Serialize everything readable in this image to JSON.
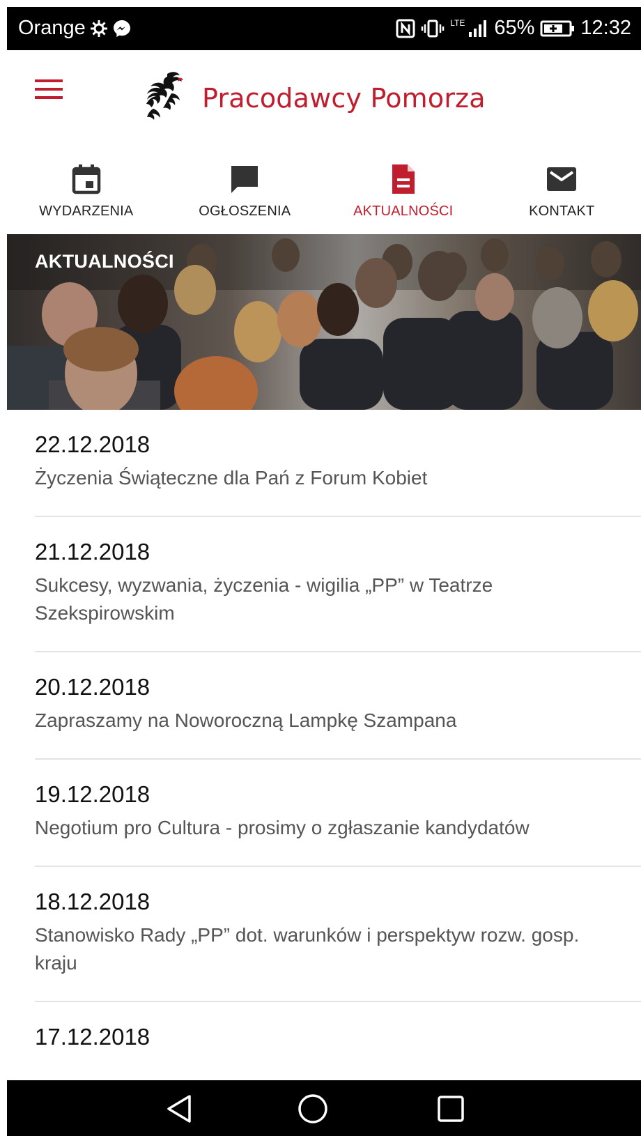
{
  "status_bar": {
    "carrier": "Orange",
    "network_label": "LTE",
    "battery": "65%",
    "time": "12:32"
  },
  "header": {
    "logo_text": "Pracodawcy Pomorza"
  },
  "tabs": [
    {
      "label": "WYDARZENIA",
      "icon": "calendar-icon",
      "active": false
    },
    {
      "label": "OGŁOSZENIA",
      "icon": "chat-bubble-icon",
      "active": false
    },
    {
      "label": "AKTUALNOŚCI",
      "icon": "document-icon",
      "active": true
    },
    {
      "label": "KONTAKT",
      "icon": "envelope-icon",
      "active": false
    }
  ],
  "hero": {
    "title": "AKTUALNOŚCI"
  },
  "news": [
    {
      "date": "22.12.2018",
      "title": "Życzenia Świąteczne dla Pań z Forum Kobiet"
    },
    {
      "date": "21.12.2018",
      "title": "Sukcesy, wyzwania, życzenia - wigilia „PP” w Teatrze Szekspirowskim"
    },
    {
      "date": "20.12.2018",
      "title": "Zapraszamy na Noworoczną Lampkę Szampana"
    },
    {
      "date": "19.12.2018",
      "title": "Negotium pro Cultura - prosimy o zgłaszanie kandydatów"
    },
    {
      "date": "18.12.2018",
      "title": "Stanowisko Rady „PP” dot. warunków i perspektyw rozw. gosp. kraju"
    },
    {
      "date": "17.12.2018",
      "title": ""
    }
  ],
  "colors": {
    "accent": "#c01e2e",
    "text_primary": "#111111",
    "text_secondary": "#555555",
    "divider": "#e3e3e3"
  }
}
